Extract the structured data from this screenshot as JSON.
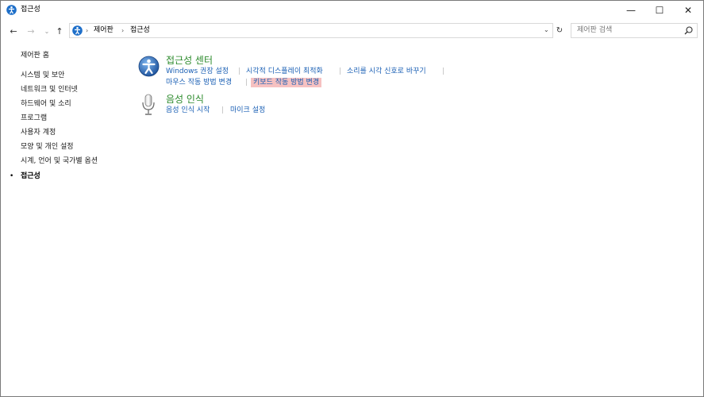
{
  "window": {
    "title": "접근성",
    "min_glyph": "—",
    "max_glyph": "☐",
    "close_glyph": "✕"
  },
  "nav": {
    "back_glyph": "←",
    "forward_glyph": "→",
    "recent_glyph": "⌄",
    "up_glyph": "↑",
    "refresh_glyph": "↻"
  },
  "address": {
    "breadcrumbs": [
      "제어판",
      "접근성"
    ],
    "separator": "›",
    "dropdown_glyph": "⌄"
  },
  "search": {
    "placeholder": "제어판 검색"
  },
  "sidebar": {
    "home": "제어판 홈",
    "items": [
      "시스템 및 보안",
      "네트워크 및 인터넷",
      "하드웨어 및 소리",
      "프로그램",
      "사용자 계정",
      "모양 및 개인 설정",
      "시계, 언어 및 국가별 옵션",
      "접근성"
    ],
    "current_bullet": "•"
  },
  "categories": [
    {
      "title": "접근성 센터",
      "icon": "ease-of-access-icon",
      "links": [
        "Windows 권장 설정",
        "시각적 디스플레이 최적화",
        "소리를 시각 신호로 바꾸기",
        "마우스 작동 방법 변경",
        "키보드 작동 방법 변경"
      ]
    },
    {
      "title": "음성 인식",
      "icon": "microphone-icon",
      "links": [
        "음성 인식 시작",
        "마이크 설정"
      ]
    }
  ],
  "colors": {
    "link": "#1a5fb4",
    "category_title": "#2b8a2b",
    "highlight": "#f6c1c1",
    "accent": "#1e6fc9"
  }
}
